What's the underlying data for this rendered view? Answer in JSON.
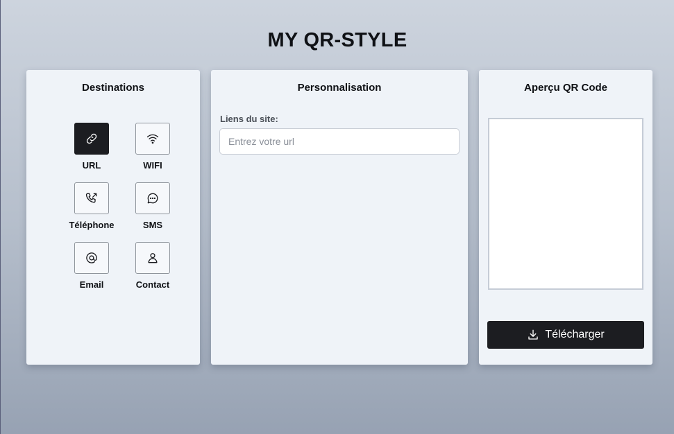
{
  "app": {
    "title": "MY QR-STYLE"
  },
  "destinations": {
    "title": "Destinations",
    "items": [
      {
        "label": "URL",
        "icon": "link-icon",
        "active": true
      },
      {
        "label": "WIFI",
        "icon": "wifi-icon",
        "active": false
      },
      {
        "label": "Téléphone",
        "icon": "phone-icon",
        "active": false
      },
      {
        "label": "SMS",
        "icon": "message-icon",
        "active": false
      },
      {
        "label": "Email",
        "icon": "at-icon",
        "active": false
      },
      {
        "label": "Contact",
        "icon": "user-icon",
        "active": false
      }
    ]
  },
  "customization": {
    "title": "Personnalisation",
    "url_label": "Liens du site:",
    "url_placeholder": "Entrez votre url",
    "url_value": ""
  },
  "preview": {
    "title": "Aperçu QR Code",
    "download_label": "Télécharger",
    "download_icon": "download-icon"
  }
}
